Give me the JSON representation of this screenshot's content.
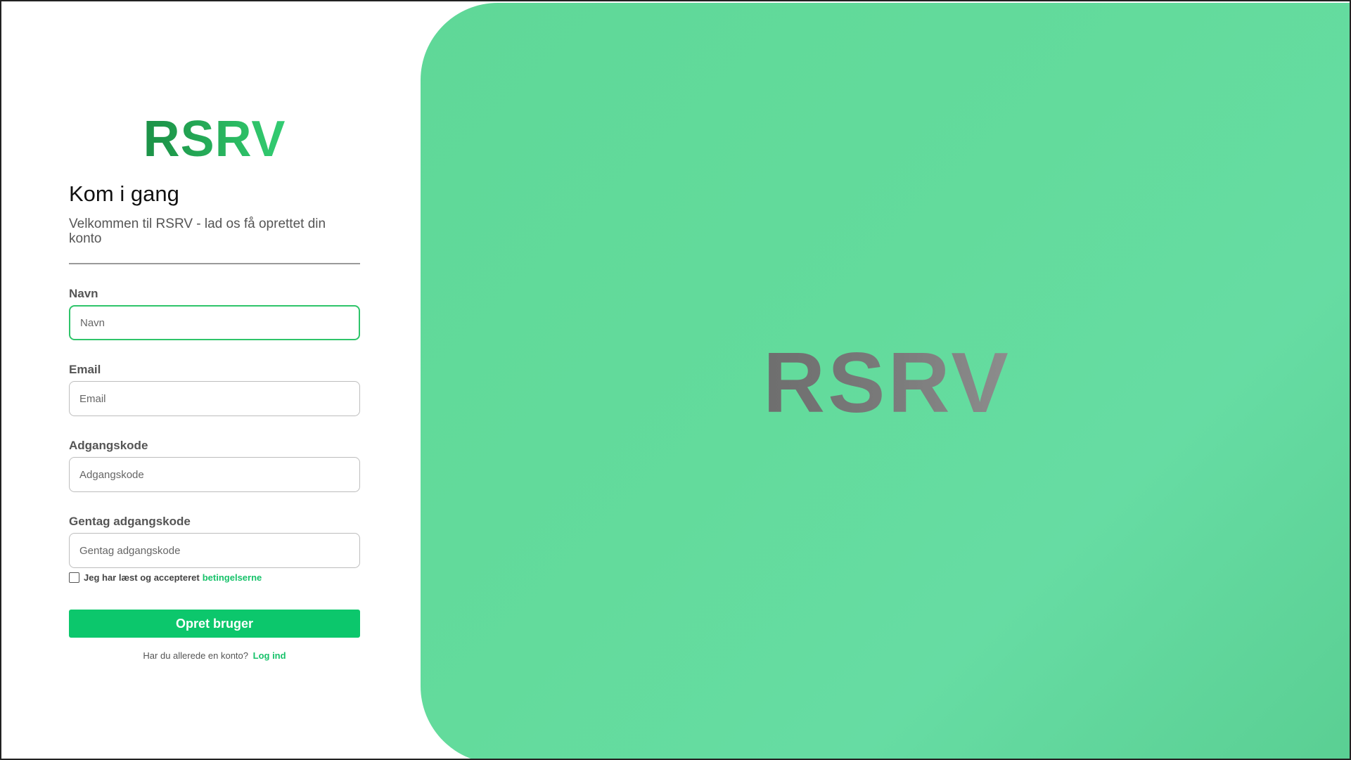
{
  "brand": {
    "logo_text": "RSRV",
    "accent": "#0cc76c"
  },
  "form": {
    "title": "Kom i gang",
    "subtitle": "Velkommen til RSRV - lad os få oprettet din konto",
    "fields": [
      {
        "label": "Navn",
        "placeholder": "Navn",
        "value": ""
      },
      {
        "label": "Email",
        "placeholder": "Email",
        "value": ""
      },
      {
        "label": "Adgangskode",
        "placeholder": "Adgangskode",
        "value": ""
      },
      {
        "label": "Gentag adgangskode",
        "placeholder": "Gentag adgangskode",
        "value": ""
      }
    ],
    "terms_text": "Jeg har læst og accepteret",
    "terms_link": "betingelserne",
    "terms_checked": false,
    "submit_label": "Opret bruger",
    "login_prompt": "Har du allerede en konto?",
    "login_link": "Log ind"
  },
  "hero": {
    "logo_text": "RSRV"
  }
}
